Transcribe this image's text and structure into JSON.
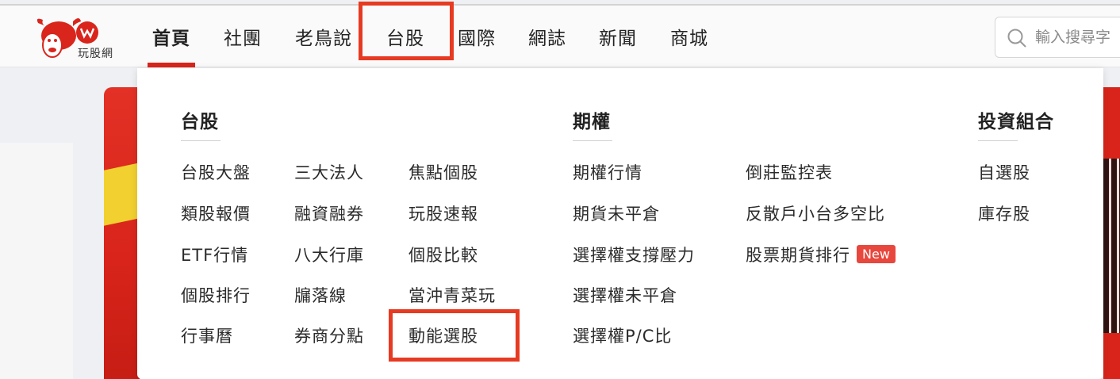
{
  "logo": {
    "text": "玩股網"
  },
  "nav": {
    "items": [
      "首頁",
      "社團",
      "老鳥說",
      "台股",
      "國際",
      "網誌",
      "新聞",
      "商城"
    ],
    "active": "首頁"
  },
  "search": {
    "placeholder": "輸入搜尋字"
  },
  "dropdown": {
    "taiwan": {
      "title": "台股",
      "col1": [
        "台股大盤",
        "類股報價",
        "ETF行情",
        "個股排行",
        "行事曆"
      ],
      "col2": [
        "三大法人",
        "融資融券",
        "八大行庫",
        "牖落線",
        "券商分點"
      ],
      "col3": [
        "焦點個股",
        "玩股速報",
        "個股比較",
        "當沖青菜玩",
        "動能選股"
      ]
    },
    "options": {
      "title": "期權",
      "col1": [
        "期權行情",
        "期貨未平倉",
        "選擇權支撐壓力",
        "選擇權未平倉",
        "選擇權P/C比"
      ],
      "col2": [
        "倒莊監控表",
        "反散戶小台多空比",
        "股票期貨排行"
      ],
      "new_badge": "New"
    },
    "portfolio": {
      "title": "投資組合",
      "items": [
        "自選股",
        "庫存股"
      ]
    }
  },
  "colors": {
    "brand": "#d9251c",
    "highlight": "#e63a22",
    "badge": "#e8473e"
  }
}
